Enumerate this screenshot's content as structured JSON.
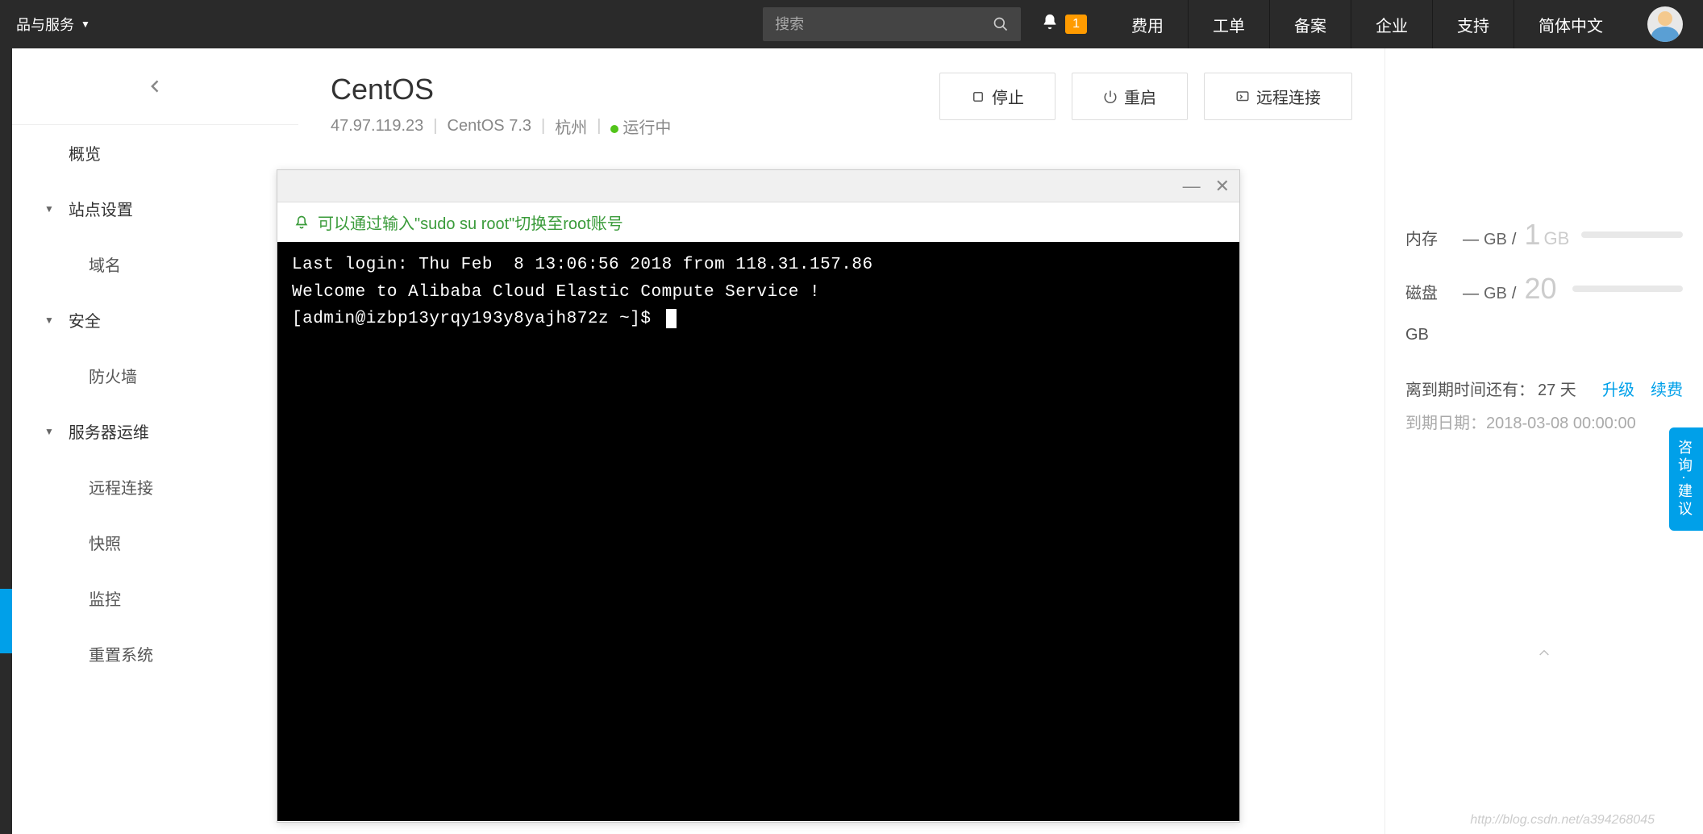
{
  "topbar": {
    "products_label": "品与服务",
    "search_placeholder": "搜索",
    "notification_count": "1",
    "nav": [
      "费用",
      "工单",
      "备案",
      "企业",
      "支持",
      "简体中文"
    ]
  },
  "sidebar": {
    "overview": "概览",
    "groups": [
      {
        "label": "站点设置",
        "items": [
          "域名"
        ]
      },
      {
        "label": "安全",
        "items": [
          "防火墙"
        ]
      },
      {
        "label": "服务器运维",
        "items": [
          "远程连接",
          "快照",
          "监控",
          "重置系统"
        ]
      }
    ]
  },
  "page": {
    "title": "CentOS",
    "ip": "47.97.119.23",
    "os": "CentOS 7.3",
    "region": "杭州",
    "status": "运行中",
    "actions": {
      "stop": "停止",
      "restart": "重启",
      "remote": "远程连接"
    }
  },
  "right": {
    "mem_label": "内存",
    "mem_used_unit": "GB",
    "mem_total": "1",
    "mem_total_unit": "GB",
    "disk_label": "磁盘",
    "disk_used_unit": "GB",
    "disk_total": "20",
    "disk_total_unit_line2": "GB",
    "expiry_prefix": "离到期时间还有：",
    "expiry_days": "27 天",
    "upgrade": "升级",
    "renew": "续费",
    "expiry_date_label": "到期日期：",
    "expiry_date": "2018-03-08 00:00:00"
  },
  "terminal": {
    "hint": "可以通过输入\"sudo su root\"切换至root账号",
    "lines": [
      "Last login: Thu Feb  8 13:06:56 2018 from 118.31.157.86",
      "",
      "Welcome to Alibaba Cloud Elastic Compute Service !",
      "",
      "[admin@izbp13yrqy193y8yajh872z ~]$ "
    ]
  },
  "feedback": "咨询·建议",
  "watermark": "http://blog.csdn.net/a394268045"
}
